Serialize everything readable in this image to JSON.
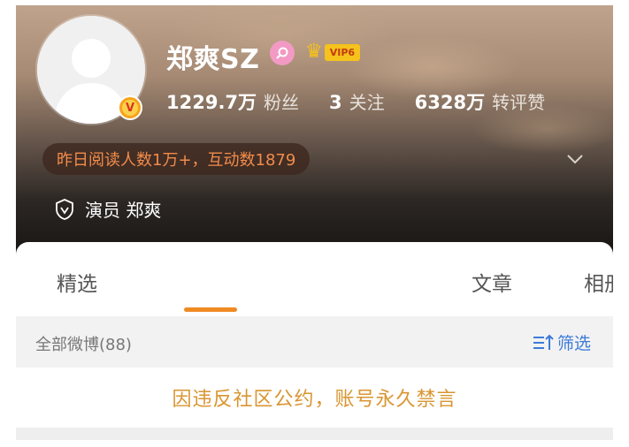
{
  "profile": {
    "username": "郑爽SZ",
    "vip_label": "VIP6",
    "followers_count": "1229.7万",
    "followers_label": "粉丝",
    "following_count": "3",
    "following_label": "关注",
    "reposts_count": "6328万",
    "reposts_label": "转评赞",
    "reading_info": "昨日阅读人数1万+，互动数1879",
    "role": "演员 郑爽",
    "verified_mark": "V"
  },
  "tabs": {
    "selected": "精选",
    "article": "文章",
    "album": "相册"
  },
  "feed": {
    "all_weibo": "全部微博(88)",
    "filter_label": "筛选",
    "ban_notice": "因违反社区公约，账号永久禁言"
  },
  "colors": {
    "accent_orange": "#f08a24",
    "reading_text": "#f28c4a",
    "filter_blue": "#3d7bd9",
    "ban_text": "#d99531",
    "vip_gold": "#f6c21c",
    "rank_pink": "#f29ac4"
  },
  "icons": {
    "avatar": "default-user-silhouette",
    "verified": "orange-v-badge-icon",
    "rank": "pink-rank-icon",
    "vip": "crown-icon",
    "expand": "chevron-down-icon",
    "role": "shield-v-icon",
    "filter": "filter-sort-icon"
  }
}
